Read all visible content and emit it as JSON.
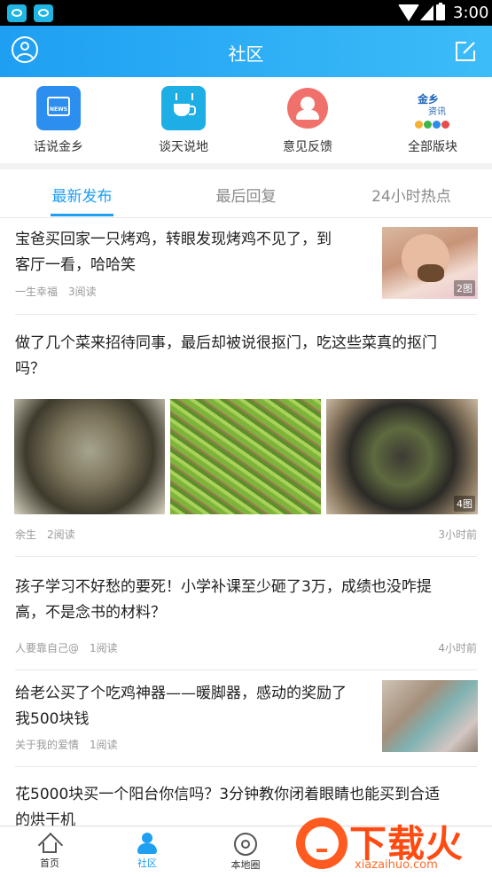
{
  "status_bar": {
    "time": "3:00"
  },
  "header": {
    "title": "社区"
  },
  "quick_links": [
    {
      "label": "话说金乡",
      "icon": "news-tv-icon",
      "color": "#2c8ff0"
    },
    {
      "label": "谈天说地",
      "icon": "tea-cup-icon",
      "color": "#1eaee6"
    },
    {
      "label": "意见反馈",
      "icon": "feedback-icon",
      "color": "#f0716c"
    },
    {
      "label": "全部版块",
      "icon": "jinxiang-news-logo",
      "logo_line1": "金乡",
      "logo_line2": "资讯"
    }
  ],
  "tabs": [
    {
      "label": "最新发布",
      "active": true
    },
    {
      "label": "最后回复",
      "active": false
    },
    {
      "label": "24小时热点",
      "active": false
    }
  ],
  "posts": [
    {
      "title_line1": "宝爸买回家一只烤鸡，转眼发现烤鸡不见了，到",
      "title_line2": "客厅一看，哈哈笑",
      "author": "一生幸福",
      "reads": "3阅读",
      "image_count": "2图",
      "time": ""
    },
    {
      "title_line1": "做了几个菜来招待同事，最后却被说很抠门，吃这些菜真的抠门",
      "title_line2": "吗？",
      "author": "余生",
      "reads": "2阅读",
      "image_count": "4图",
      "time": "3小时前"
    },
    {
      "title_line1": "孩子学习不好愁的要死！小学补课至少砸了3万，成绩也没咋提",
      "title_line2": "高，不是念书的材料？",
      "author": "人要靠自己@",
      "reads": "1阅读",
      "time": "4小时前"
    },
    {
      "title_line1": "给老公买了个吃鸡神器——暖脚器，感动的奖励了",
      "title_line2": "我500块钱",
      "author": "关于我的爱情",
      "reads": "1阅读",
      "time": ""
    },
    {
      "title_line1": "花5000块买一个阳台你信吗？3分钟教你闭着眼睛也能买到合适",
      "title_line2": "的烘干机"
    }
  ],
  "bottom_nav": [
    {
      "label": "首页",
      "active": false
    },
    {
      "label": "社区",
      "active": true
    },
    {
      "label": "本地圈",
      "active": false
    }
  ],
  "watermark": {
    "brand": "下载火",
    "domain": "xiazaihuo.com"
  }
}
